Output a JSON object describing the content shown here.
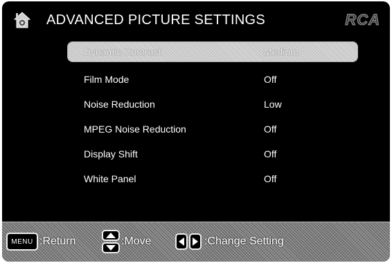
{
  "header": {
    "title": "ADVANCED PICTURE SETTINGS",
    "brand": "RCA"
  },
  "menu": {
    "items": [
      {
        "label": "Dynamic Contrast",
        "value": "Medium",
        "selected": true
      },
      {
        "label": "Film Mode",
        "value": "Off",
        "selected": false
      },
      {
        "label": "Noise Reduction",
        "value": "Low",
        "selected": false
      },
      {
        "label": "MPEG Noise Reduction",
        "value": "Off",
        "selected": false
      },
      {
        "label": "Display Shift",
        "value": "Off",
        "selected": false
      },
      {
        "label": "White Panel",
        "value": "Off",
        "selected": false
      }
    ]
  },
  "footer": {
    "menu_key": "MENU",
    "return_label": ":Return",
    "move_label": ":Move",
    "change_label": ":Change Setting"
  },
  "icons": [
    "home-icon",
    "up-arrow-icon",
    "down-arrow-icon",
    "left-arrow-icon",
    "right-arrow-icon"
  ]
}
